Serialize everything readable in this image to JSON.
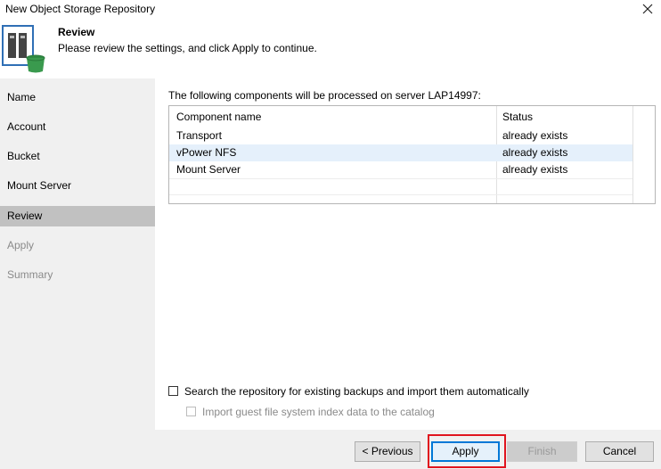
{
  "window": {
    "title": "New Object Storage Repository"
  },
  "header": {
    "title": "Review",
    "subtitle": "Please review the settings, and click Apply to continue."
  },
  "sidebar": {
    "items": [
      {
        "label": "Name"
      },
      {
        "label": "Account"
      },
      {
        "label": "Bucket"
      },
      {
        "label": "Mount Server"
      },
      {
        "label": "Review"
      },
      {
        "label": "Apply"
      },
      {
        "label": "Summary"
      }
    ]
  },
  "content": {
    "intro": "The following components will be processed on server LAP14997:",
    "table": {
      "headers": [
        "Component name",
        "Status"
      ],
      "rows": [
        {
          "component": "Transport",
          "status": "already exists"
        },
        {
          "component": "vPower NFS",
          "status": "already exists"
        },
        {
          "component": "Mount Server",
          "status": "already exists"
        }
      ]
    },
    "options": {
      "search_label": "Search the repository for existing backups and import them automatically",
      "search_checked": false,
      "import_label": "Import guest file system index data to the catalog",
      "import_checked": false
    }
  },
  "footer": {
    "previous": "< Previous",
    "apply": "Apply",
    "finish": "Finish",
    "cancel": "Cancel"
  },
  "colors": {
    "sidebar_bg": "#f0f0f0",
    "sidebar_active": "#c1c1c1",
    "row_highlight": "#e5f0fb",
    "focus_blue": "#0078d7",
    "annotation_red": "#e0141e",
    "icon_green": "#3a9a4e",
    "icon_blue": "#2f6fb5"
  },
  "icons": {
    "close": "close-icon",
    "header": "object-storage-repository-icon"
  }
}
